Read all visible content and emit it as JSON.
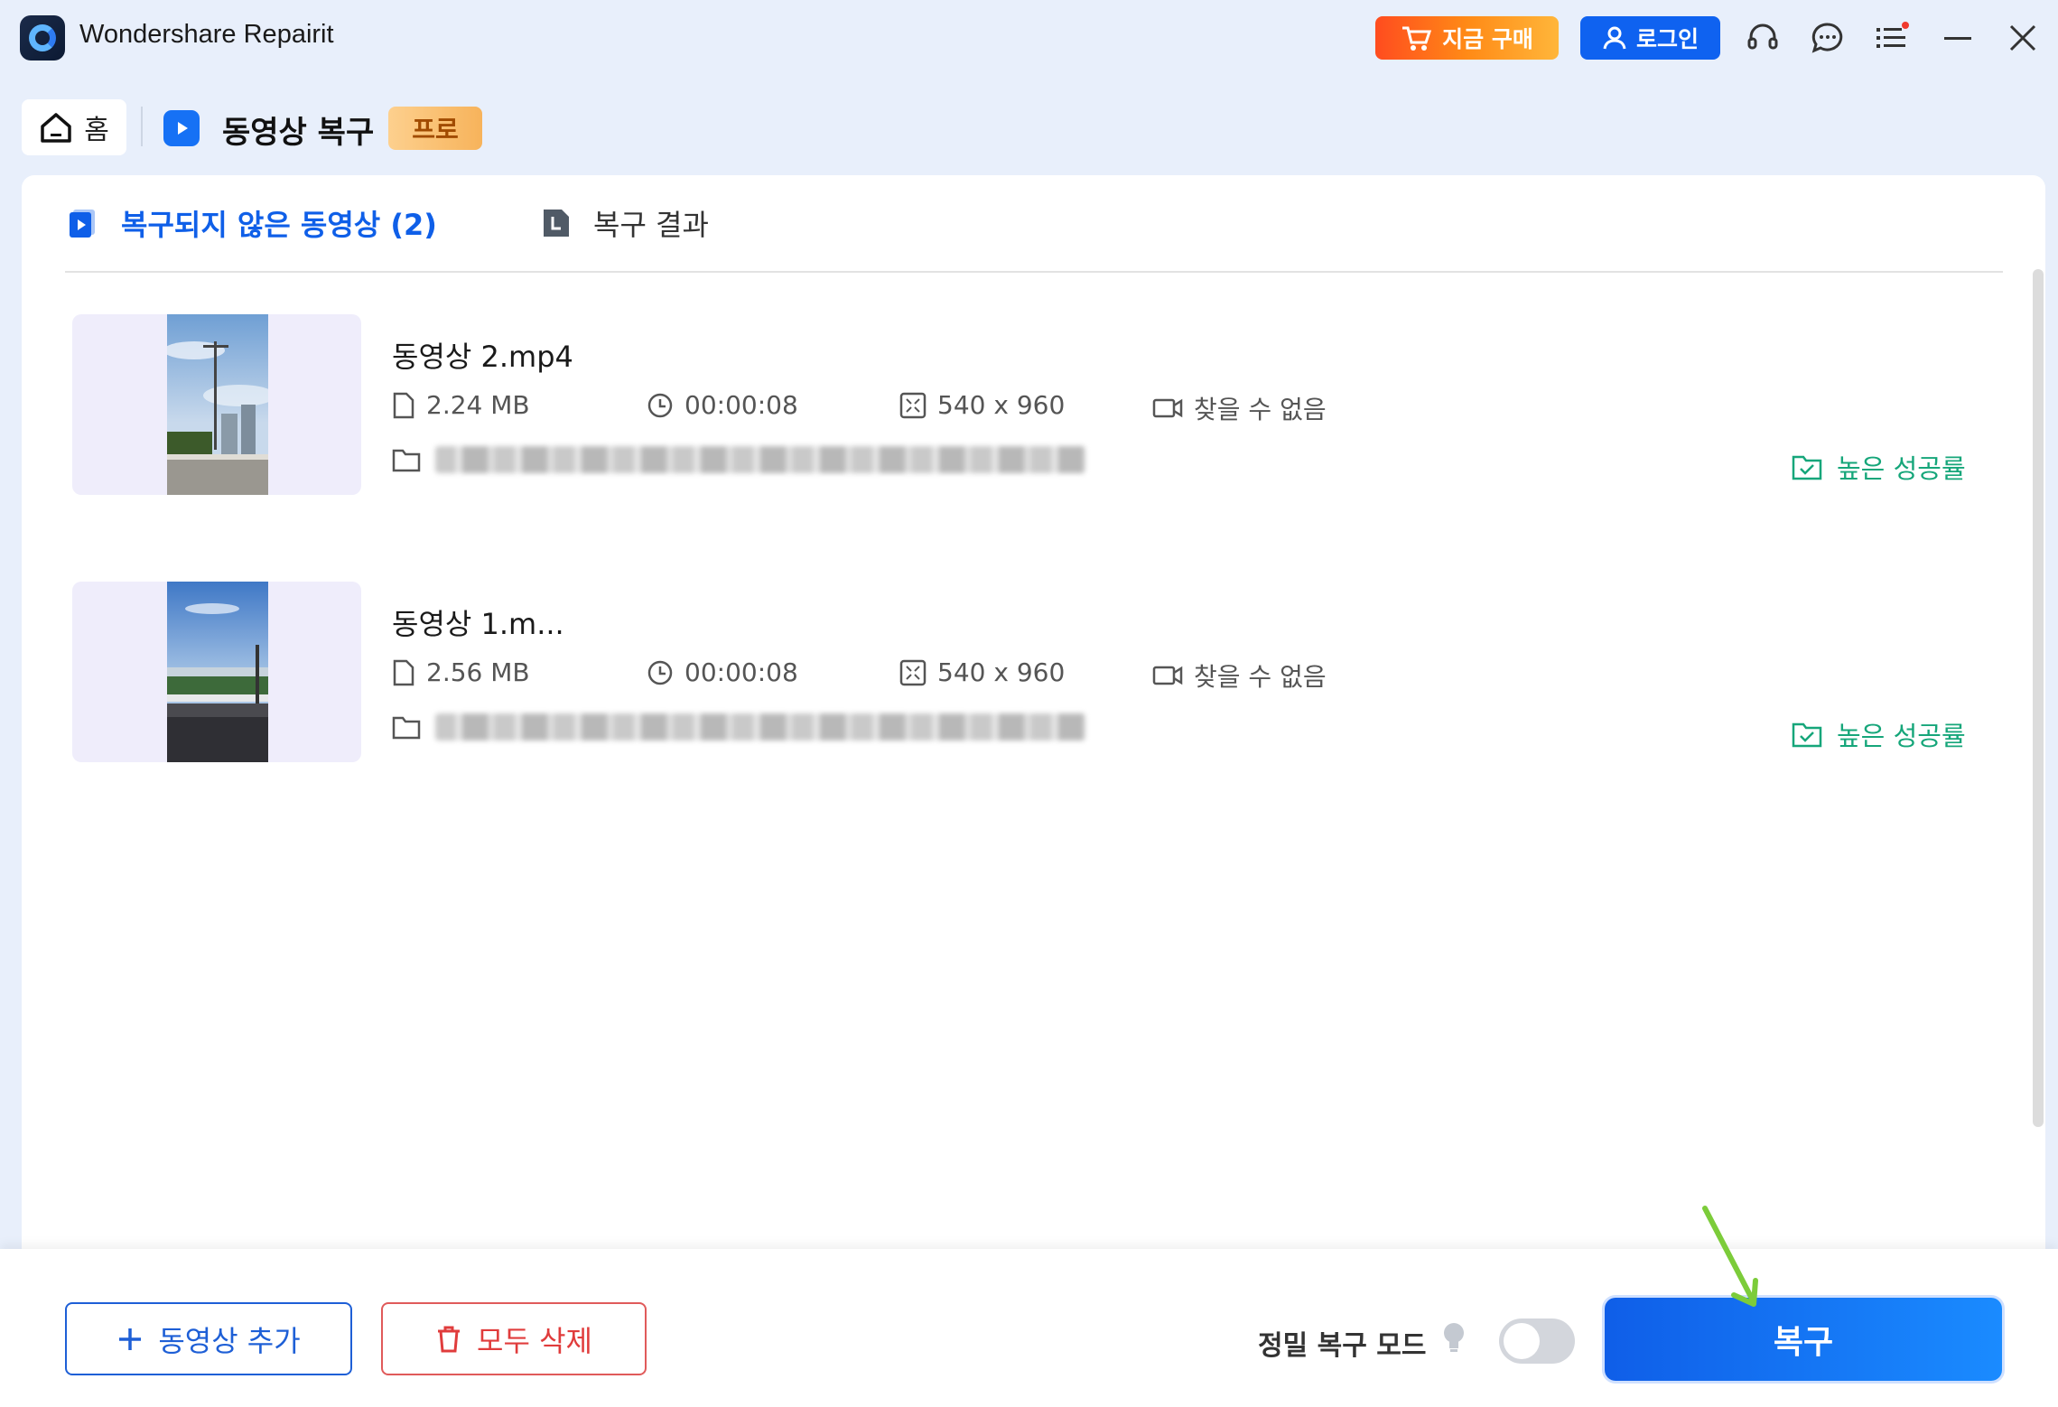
{
  "window": {
    "app_title": "Wondershare Repairit",
    "buy_label": "지금 구매",
    "login_label": "로그인",
    "icons": [
      "support-headset-icon",
      "feedback-chat-icon",
      "menu-list-icon",
      "minimize-icon",
      "close-icon"
    ]
  },
  "breadcrumb": {
    "home_label": "홈",
    "section_title": "동영상 복구",
    "badge": "프로"
  },
  "tabs": [
    {
      "label": "복구되지 않은 동영상 (2)",
      "active": true
    },
    {
      "label": "복구 결과",
      "active": false
    }
  ],
  "files": [
    {
      "name": "동영상 2.mp4",
      "size": "2.24 MB",
      "duration": "00:00:08",
      "resolution": "540 x 960",
      "device": "찾을 수 없음",
      "path": "C:\\Users\\...\\동영상 2.mp4",
      "status": "높은 성공률"
    },
    {
      "name": "동영상 1.m...",
      "size": "2.56 MB",
      "duration": "00:00:08",
      "resolution": "540 x 960",
      "device": "찾을 수 없음",
      "path": "C:\\Users\\...\\동영상 1.mp4",
      "status": "높은 성공률"
    }
  ],
  "footer": {
    "add_label": "동영상 추가",
    "delete_label": "모두 삭제",
    "mode_label": "정밀 복구 모드",
    "mode_enabled": false,
    "repair_label": "복구"
  },
  "colors": {
    "accent": "#0f62f0",
    "success": "#16a67a",
    "danger": "#e03c3c",
    "buy": "#ff6a1a"
  }
}
